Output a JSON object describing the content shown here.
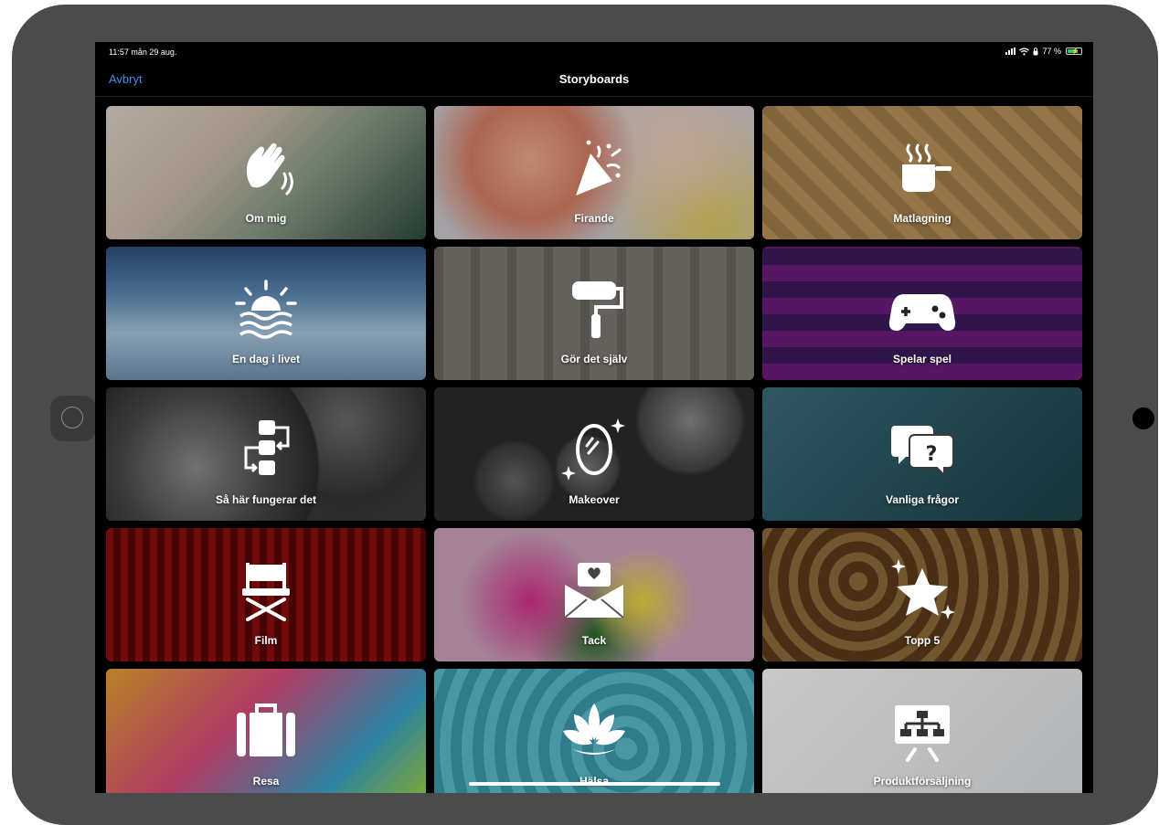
{
  "status_bar": {
    "time_date": "11:57  mån 29 aug.",
    "battery_percent": "77 %",
    "battery_level": 0.77
  },
  "nav": {
    "cancel_label": "Avbryt",
    "title": "Storyboards"
  },
  "tiles": [
    {
      "label": "Om mig",
      "icon": "waving-hand-icon"
    },
    {
      "label": "Firande",
      "icon": "party-popper-icon"
    },
    {
      "label": "Matlagning",
      "icon": "cooking-pot-icon"
    },
    {
      "label": "En dag i livet",
      "icon": "sunset-icon"
    },
    {
      "label": "Gör det själv",
      "icon": "paint-roller-icon"
    },
    {
      "label": "Spelar spel",
      "icon": "game-controller-icon"
    },
    {
      "label": "Så här fungerar det",
      "icon": "process-flow-icon"
    },
    {
      "label": "Makeover",
      "icon": "mirror-sparkle-icon"
    },
    {
      "label": "Vanliga frågor",
      "icon": "question-bubbles-icon"
    },
    {
      "label": "Film",
      "icon": "director-chair-icon"
    },
    {
      "label": "Tack",
      "icon": "heart-envelope-icon"
    },
    {
      "label": "Topp 5",
      "icon": "star-sparkle-icon"
    },
    {
      "label": "Resa",
      "icon": "suitcase-icon"
    },
    {
      "label": "Hälsa",
      "icon": "lotus-icon"
    },
    {
      "label": "Produktförsäljning",
      "icon": "presentation-chart-icon"
    }
  ]
}
